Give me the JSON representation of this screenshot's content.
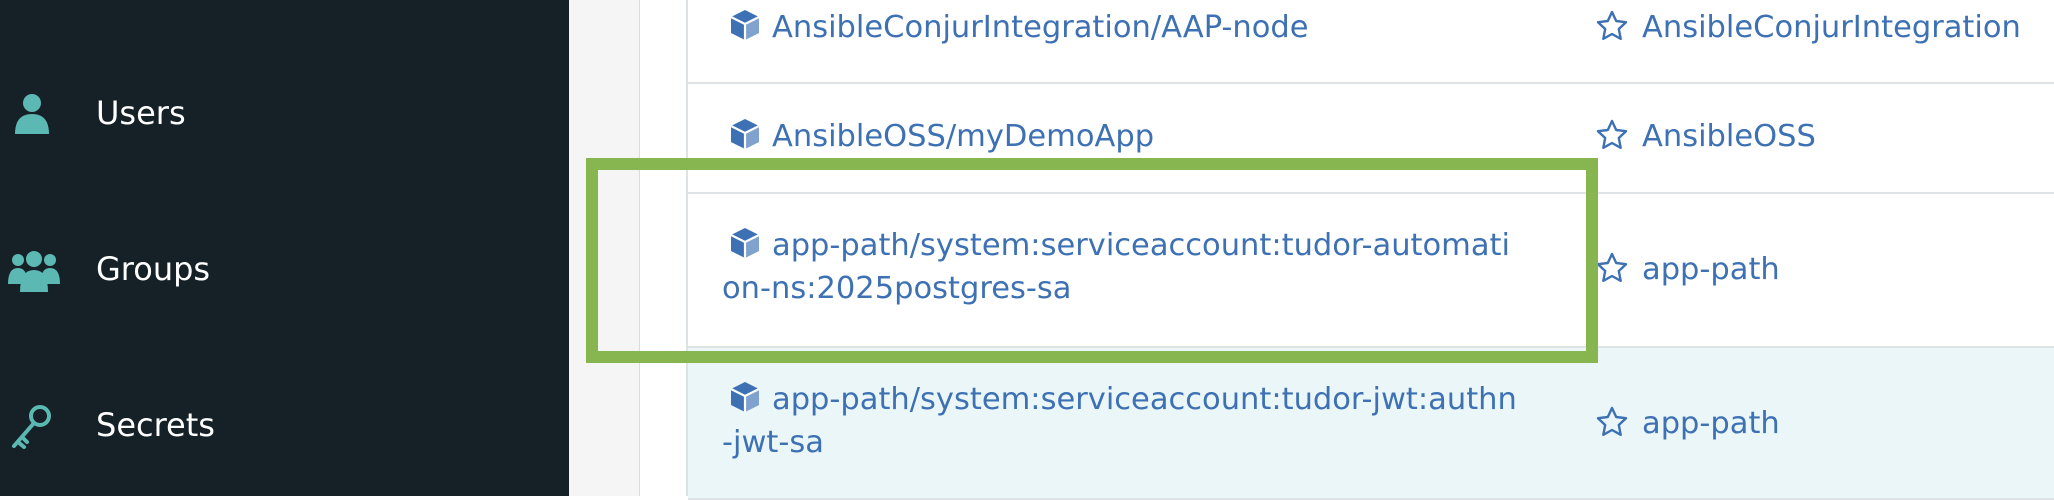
{
  "sidebar": {
    "items": [
      {
        "label": "Users",
        "icon": "user-icon"
      },
      {
        "label": "Groups",
        "icon": "users-group-icon"
      },
      {
        "label": "Secrets",
        "icon": "key-icon"
      }
    ]
  },
  "table": {
    "rows": [
      {
        "resource_id": "AnsibleConjurIntegration/AAP-node",
        "owner": "AnsibleConjurIntegration",
        "resource_icon": "cube-icon",
        "owner_icon": "star-outline-icon"
      },
      {
        "resource_id": "AnsibleOSS/myDemoApp",
        "owner": "AnsibleOSS",
        "resource_icon": "cube-icon",
        "owner_icon": "star-outline-icon"
      },
      {
        "resource_id": "app-path/system:serviceaccount:tudor-automation-ns:2025postgres-sa",
        "owner": "app-path",
        "resource_icon": "cube-icon",
        "owner_icon": "star-outline-icon"
      },
      {
        "resource_id": "app-path/system:serviceaccount:tudor-jwt:authn-jwt-sa",
        "owner": "app-path",
        "resource_icon": "cube-icon",
        "owner_icon": "star-outline-icon"
      }
    ]
  },
  "colors": {
    "sidebar_bg": "#152127",
    "sidebar_icon": "#5cb8b2",
    "link": "#3d71b4",
    "highlight_border": "#87b651",
    "alt_row_bg": "#eaf6f7"
  }
}
